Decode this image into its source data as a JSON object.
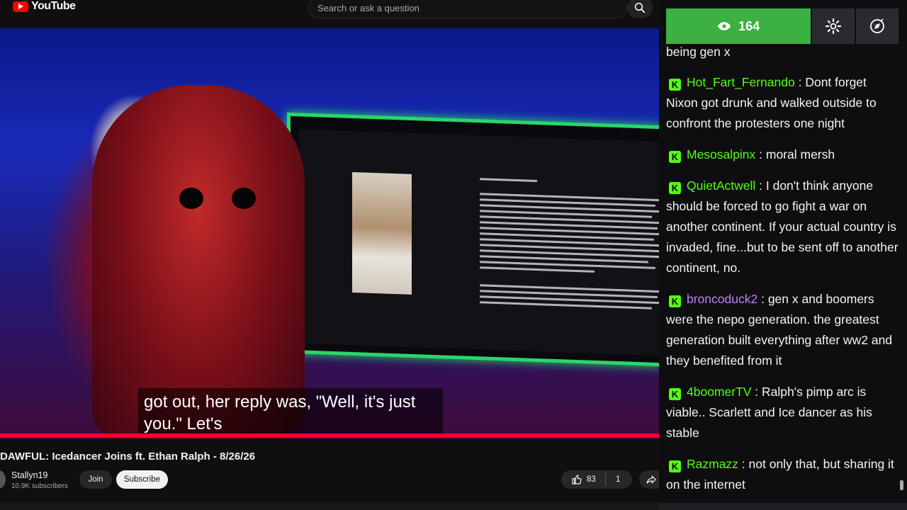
{
  "header": {
    "logo_text": "YouTube",
    "search_placeholder": "Search or ask a question"
  },
  "video": {
    "caption_line1": "got out, her reply was, \"Well, it's just",
    "caption_line2": "you.\" Let's",
    "title": "DAWFUL: Icedancer Joins ft. Ethan Ralph - 8/26/26",
    "channel": "Stallyn19",
    "subscribers": "10.9K subscribers",
    "join_label": "Join",
    "subscribe_label": "Subscribe",
    "likes": "83",
    "dislikes": "1"
  },
  "chat": {
    "viewer_count": "164",
    "accent": "#3cb043",
    "badge_color": "#53fc18",
    "partial_message": "being gen x",
    "messages": [
      {
        "user": "Hot_Fart_Fernando",
        "color": "#53fc18",
        "text": "Dont forget Nixon got drunk and walked outside to confront the protesters one night"
      },
      {
        "user": "Mesosalpinx",
        "color": "#53fc18",
        "text": "moral mersh"
      },
      {
        "user": "QuietActwell",
        "color": "#53fc18",
        "text": "I don't think anyone should be forced to go fight a war on another continent. If your actual country is invaded, fine...but to be sent off to another continent, no."
      },
      {
        "user": "broncoduck2",
        "color": "#c27ff7",
        "text": "gen x and boomers were the nepo generation. the greatest generation built everything after ww2 and they benefited from it"
      },
      {
        "user": "4boomerTV",
        "color": "#53fc18",
        "text": "Ralph's pimp arc is viable.. Scarlett and Ice dancer as his stable"
      },
      {
        "user": "Razmazz",
        "color": "#53fc18",
        "text": "not only that, but sharing it on the internet"
      }
    ]
  }
}
